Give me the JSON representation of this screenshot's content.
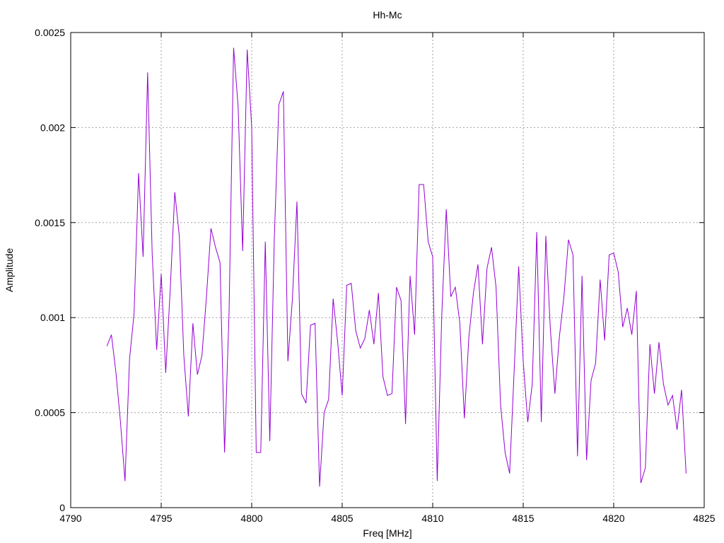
{
  "chart_data": {
    "type": "line",
    "title": "Hh-Mc",
    "xlabel": "Freq [MHz]",
    "ylabel": "Amplitude",
    "xlim": [
      4790,
      4825
    ],
    "ylim": [
      0,
      0.0025
    ],
    "x_ticks": [
      "4790",
      "4795",
      "4800",
      "4805",
      "4810",
      "4815",
      "4820",
      "4825"
    ],
    "y_ticks": [
      "0",
      "0.0005",
      "0.001",
      "0.0015",
      "0.002",
      "0.0025"
    ],
    "grid": true,
    "colors": {
      "series": "#9400d3"
    },
    "series": [
      {
        "x": [
          4792.0,
          4792.25,
          4792.5,
          4792.75,
          4793.0,
          4793.25,
          4793.5,
          4793.75,
          4794.0,
          4794.25,
          4794.5,
          4794.75,
          4795.0,
          4795.25,
          4795.5,
          4795.75,
          4796.0,
          4796.25,
          4796.5,
          4796.75,
          4797.0,
          4797.25,
          4797.5,
          4797.75,
          4798.0,
          4798.25,
          4798.5,
          4798.75,
          4799.0,
          4799.25,
          4799.5,
          4799.75,
          4800.0,
          4800.25,
          4800.5,
          4800.75,
          4801.0,
          4801.25,
          4801.5,
          4801.75,
          4802.0,
          4802.25,
          4802.5,
          4802.75,
          4803.0,
          4803.25,
          4803.5,
          4803.75,
          4804.0,
          4804.25,
          4804.5,
          4804.75,
          4805.0,
          4805.25,
          4805.5,
          4805.75,
          4806.0,
          4806.25,
          4806.5,
          4806.75,
          4807.0,
          4807.25,
          4807.5,
          4807.75,
          4808.0,
          4808.25,
          4808.5,
          4808.75,
          4809.0,
          4809.25,
          4809.5,
          4809.75,
          4810.0,
          4810.25,
          4810.5,
          4810.75,
          4811.0,
          4811.25,
          4811.5,
          4811.75,
          4812.0,
          4812.25,
          4812.5,
          4812.75,
          4813.0,
          4813.25,
          4813.5,
          4813.75,
          4814.0,
          4814.25,
          4814.5,
          4814.75,
          4815.0,
          4815.25,
          4815.5,
          4815.75,
          4816.0,
          4816.25,
          4816.5,
          4816.75,
          4817.0,
          4817.25,
          4817.5,
          4817.75,
          4818.0,
          4818.25,
          4818.5,
          4818.75,
          4819.0,
          4819.25,
          4819.5,
          4819.75,
          4820.0,
          4820.25,
          4820.5,
          4820.75,
          4821.0,
          4821.25,
          4821.5,
          4821.75,
          4822.0,
          4822.25,
          4822.5,
          4822.75,
          4823.0,
          4823.25,
          4823.5,
          4823.75,
          4824.0
        ],
        "y": [
          0.00085,
          0.00091,
          0.00071,
          0.00045,
          0.00014,
          0.00078,
          0.00102,
          0.00176,
          0.00132,
          0.00229,
          0.00134,
          0.00083,
          0.00123,
          0.00071,
          0.00115,
          0.00166,
          0.00143,
          0.0008,
          0.00048,
          0.00097,
          0.0007,
          0.0008,
          0.00111,
          0.00147,
          0.00137,
          0.00129,
          0.00029,
          0.00103,
          0.00242,
          0.00211,
          0.00135,
          0.00241,
          0.002,
          0.00029,
          0.00029,
          0.0014,
          0.00035,
          0.00142,
          0.00212,
          0.00219,
          0.00077,
          0.0011,
          0.00161,
          0.0006,
          0.00055,
          0.00096,
          0.00097,
          0.00011,
          0.0005,
          0.00057,
          0.0011,
          0.00087,
          0.00059,
          0.00117,
          0.00118,
          0.00093,
          0.00084,
          0.00089,
          0.00104,
          0.00086,
          0.00113,
          0.00069,
          0.00059,
          0.0006,
          0.00116,
          0.00109,
          0.00044,
          0.00122,
          0.00091,
          0.0017,
          0.0017,
          0.0014,
          0.00132,
          0.00014,
          0.00101,
          0.00157,
          0.00111,
          0.00116,
          0.00097,
          0.00047,
          0.0009,
          0.00113,
          0.00128,
          0.00086,
          0.00126,
          0.00137,
          0.00116,
          0.00054,
          0.00029,
          0.00018,
          0.00072,
          0.00127,
          0.00077,
          0.00045,
          0.00065,
          0.00145,
          0.00045,
          0.00143,
          0.00094,
          0.0006,
          0.0009,
          0.00111,
          0.00141,
          0.00133,
          0.00027,
          0.00122,
          0.00025,
          0.00067,
          0.00076,
          0.0012,
          0.00088,
          0.00133,
          0.00134,
          0.00124,
          0.00095,
          0.00105,
          0.00091,
          0.00114,
          0.00013,
          0.00021,
          0.00086,
          0.0006,
          0.00087,
          0.00065,
          0.00054,
          0.00059,
          0.00041,
          0.00062,
          0.00018
        ]
      }
    ]
  }
}
